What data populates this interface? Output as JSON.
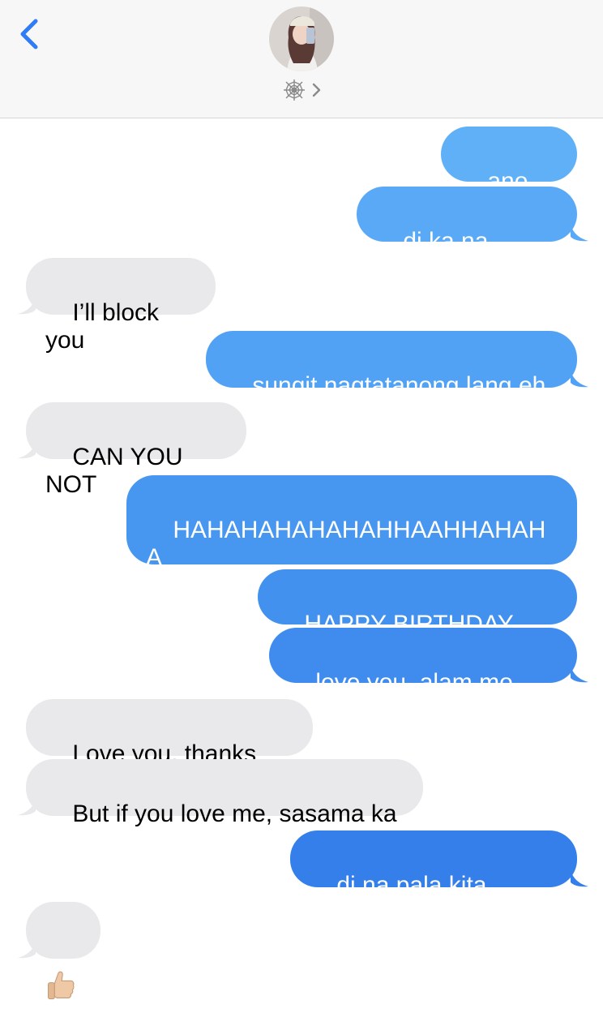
{
  "header": {
    "back_icon": "chevron-left-icon",
    "contact_icon": "spiderweb-icon",
    "chevron_icon": "chevron-right-icon"
  },
  "messages": [
    {
      "from": "me",
      "text": "ano beh"
    },
    {
      "from": "me",
      "text": "di ka na binati?"
    },
    {
      "from": "them",
      "text": "I’ll block you"
    },
    {
      "from": "me",
      "text": "sungit nagtatanong lang eh"
    },
    {
      "from": "them",
      "text": "CAN YOU NOT"
    },
    {
      "from": "me",
      "text": "HAHAHAHAHAHAHHAAHHAHAH\nA"
    },
    {
      "from": "me",
      "text": "HAPPY BIRTHDAY JAN"
    },
    {
      "from": "me",
      "text": "love you, alam mo yan"
    },
    {
      "from": "them",
      "text": "Love you, thanks",
      "emoji": "thumbs-up-icon"
    },
    {
      "from": "them",
      "text": "But if you love me, sasama ka"
    },
    {
      "from": "me",
      "text": "di na pala kita mahal"
    },
    {
      "from": "them",
      "text": "",
      "emoji": "thumbs-up-icon"
    }
  ],
  "colors": {
    "outgoing": "#4a9df2",
    "incoming": "#e9e9eb",
    "accent": "#2f7cf6"
  }
}
